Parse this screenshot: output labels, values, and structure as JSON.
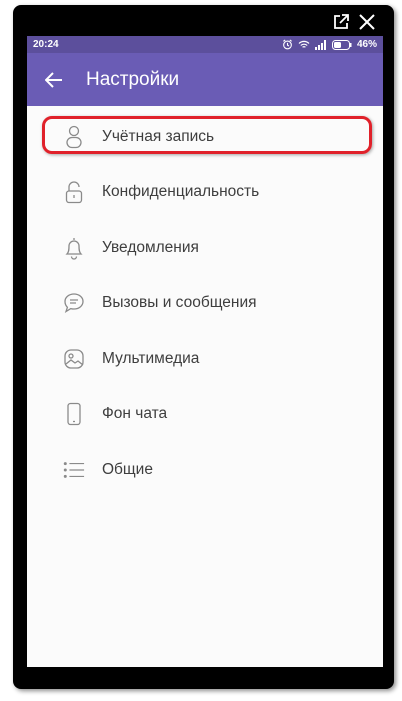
{
  "window_controls": {
    "popout_icon": "popout-icon",
    "close_icon": "close-icon"
  },
  "statusbar": {
    "time": "20:24",
    "battery": "46%",
    "icons": [
      "alarm-icon",
      "wifi-icon",
      "signal-icon",
      "battery-icon"
    ]
  },
  "appbar": {
    "title": "Настройки",
    "back_icon": "back-arrow-icon"
  },
  "settings": {
    "items": [
      {
        "label": "Учётная запись",
        "icon": "account-icon",
        "highlighted": true
      },
      {
        "label": "Конфиденциальность",
        "icon": "lock-icon"
      },
      {
        "label": "Уведомления",
        "icon": "bell-icon"
      },
      {
        "label": "Вызовы и сообщения",
        "icon": "chat-bubble-icon"
      },
      {
        "label": "Мультимедиа",
        "icon": "media-icon"
      },
      {
        "label": "Фон чата",
        "icon": "phone-icon"
      },
      {
        "label": "Общие",
        "icon": "list-icon"
      }
    ]
  },
  "colors": {
    "statusbar": "#5c4f9c",
    "appbar": "#6a5cb5",
    "highlight": "#e0212a"
  }
}
